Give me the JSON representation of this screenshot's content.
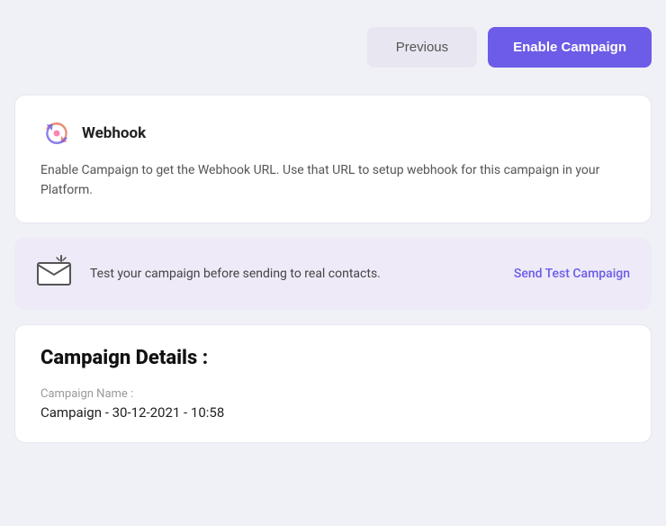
{
  "toolbar": {
    "previous_label": "Previous",
    "enable_label": "Enable Campaign"
  },
  "webhook": {
    "icon": "🔗",
    "title": "Webhook",
    "description": "Enable Campaign to get the Webhook URL. Use that URL to setup webhook for this campaign in your Platform."
  },
  "test_banner": {
    "text": "Test your campaign before sending to real contacts.",
    "action_label": "Send Test Campaign"
  },
  "campaign_details": {
    "title": "Campaign Details :",
    "name_label": "Campaign Name :",
    "name_value": "Campaign - 30-12-2021 - 10:58"
  }
}
